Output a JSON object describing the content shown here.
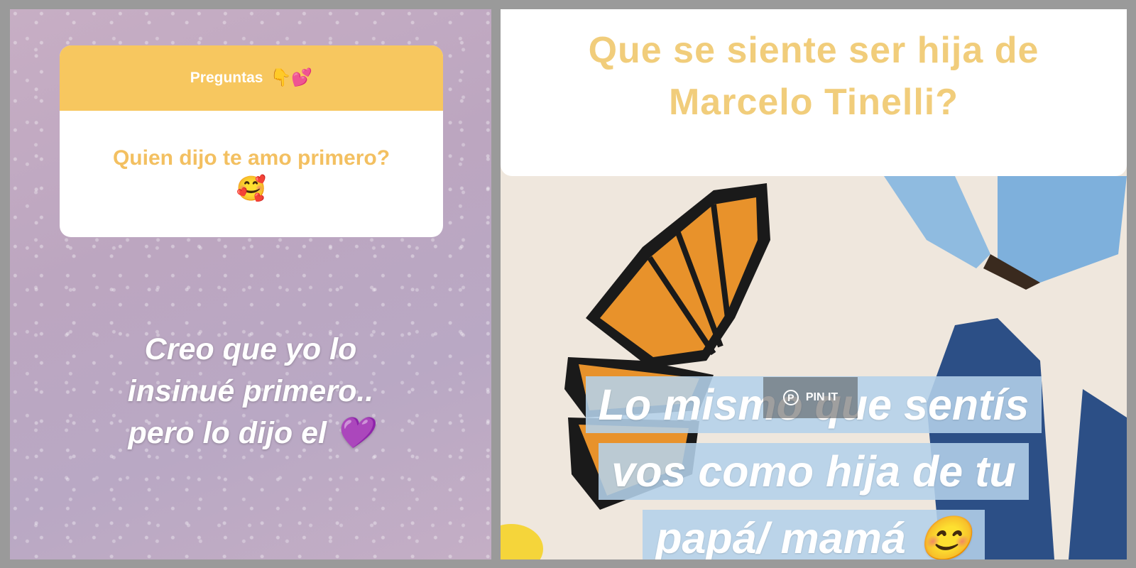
{
  "left_story": {
    "question_box": {
      "header": "Preguntas",
      "header_emojis": "👇💕",
      "question": "Quien dijo te amo primero?",
      "question_emoji": "🥰"
    },
    "answer_lines": [
      "Creo que yo lo",
      "insinué primero..",
      "pero lo dijo el 💜"
    ]
  },
  "right_story": {
    "question_lines": [
      "Que se siente ser hija de",
      "Marcelo Tinelli?"
    ],
    "answer_lines": [
      "Lo mismo que sentís",
      "vos como hija de tu",
      "papá/ mamá 😊"
    ]
  },
  "overlay": {
    "pin_label": "PIN IT",
    "pin_icon": "pinterest-icon"
  },
  "colors": {
    "header_yellow": "#f7c75f",
    "question_text": "#f3c061",
    "title_text": "#f1cd7b",
    "answer_highlight": "#b4d2eb"
  }
}
